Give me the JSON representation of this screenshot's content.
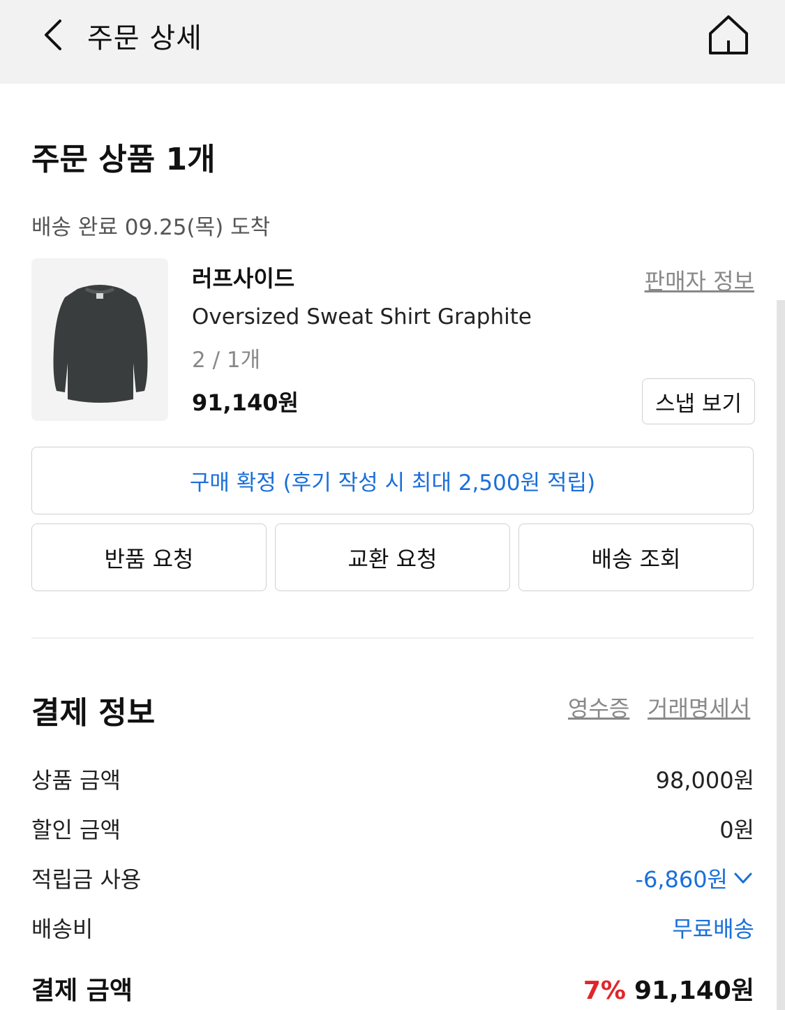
{
  "header": {
    "title": "주문 상세"
  },
  "order": {
    "title": "주문 상품 1개",
    "status": "배송 완료 09.25(목) 도착",
    "product": {
      "brand": "러프사이드",
      "seller_link": "판매자 정보",
      "name": "Oversized Sweat Shirt Graphite",
      "option": "2 / 1개",
      "price": "91,140원",
      "snap_button": "스냅 보기"
    },
    "confirm_button": "구매 확정 (후기 작성 시 최대 2,500원 적립)",
    "actions": {
      "return": "반품 요청",
      "exchange": "교환 요청",
      "tracking": "배송 조회"
    }
  },
  "payment": {
    "title": "결제 정보",
    "receipt_link": "영수증",
    "statement_link": "거래명세서",
    "rows": [
      {
        "label": "상품 금액",
        "value": "98,000원"
      },
      {
        "label": "할인 금액",
        "value": "0원"
      },
      {
        "label": "적립금 사용",
        "value": "-6,860원"
      },
      {
        "label": "배송비",
        "value": "무료배송"
      }
    ],
    "total_label": "결제 금액",
    "total_rate": "7%",
    "total_value": "91,140원"
  },
  "colors": {
    "accent_blue": "#1a6fd9",
    "discount_red": "#e0262a",
    "header_bg": "#f2f2f2"
  },
  "icons": {
    "back": "chevron-left-icon",
    "home": "home-icon",
    "expand": "chevron-down-icon"
  }
}
